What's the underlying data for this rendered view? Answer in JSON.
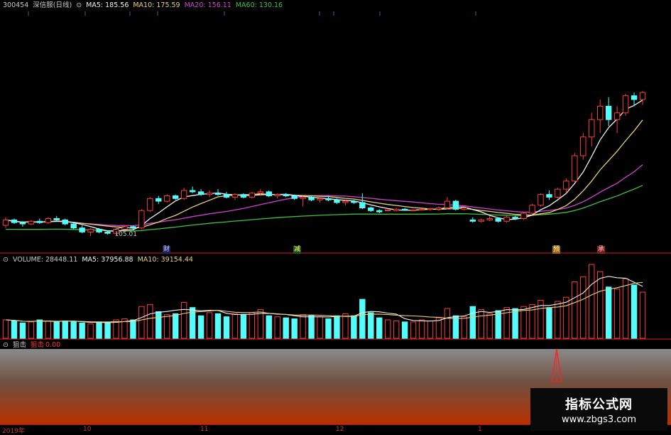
{
  "price": {
    "legend": {
      "code": "300454",
      "name": "深信服(日线)",
      "ma5": "MA5: 185.56",
      "ma10": "MA10: 175.59",
      "ma20": "MA20: 156.11",
      "ma60": "MA60: 130.16"
    },
    "low_label": "105.01",
    "markers": [
      "财",
      "减",
      "预",
      "承"
    ]
  },
  "volume": {
    "legend": {
      "volume": "VOLUME: 28448.11",
      "ma5": "MA5: 37956.88",
      "ma10": "MA10: 39154.44"
    }
  },
  "indicator": {
    "name": "狙击",
    "label": "狙击",
    "value": "0.00"
  },
  "x_axis": [
    "2019年",
    "10",
    "11",
    "12",
    "1"
  ],
  "brand": {
    "line1": "指标公式网",
    "line2": "www.zbgs3.com"
  },
  "colors": {
    "up": "#ff3a3a",
    "down": "#54fcfc",
    "ma5": "#f0f0f0",
    "ma10": "#e8d07a",
    "ma20": "#d040d0",
    "ma60": "#40c040",
    "axis": "#b01818"
  },
  "chart_data": {
    "type": "candlestick",
    "candles": [
      [
        106,
        112,
        104,
        110
      ],
      [
        110,
        111,
        107,
        108
      ],
      [
        108,
        109,
        105,
        107
      ],
      [
        107,
        110,
        106,
        109
      ],
      [
        109,
        111,
        107,
        108
      ],
      [
        108,
        112,
        107,
        111
      ],
      [
        111,
        113,
        109,
        110
      ],
      [
        110,
        111,
        106,
        107
      ],
      [
        107,
        108,
        103,
        104
      ],
      [
        104,
        106,
        100,
        101
      ],
      [
        101,
        104,
        98,
        103
      ],
      [
        103,
        104,
        100,
        101
      ],
      [
        101,
        102,
        99,
        100
      ],
      [
        100,
        104,
        99,
        103
      ],
      [
        103,
        106,
        105.01,
        105
      ],
      [
        105,
        106,
        103,
        104
      ],
      [
        104,
        118,
        103,
        117
      ],
      [
        117,
        127,
        116,
        126
      ],
      [
        126,
        128,
        122,
        124
      ],
      [
        124,
        129,
        123,
        128
      ],
      [
        128,
        129,
        125,
        126
      ],
      [
        126,
        134,
        125,
        132
      ],
      [
        132,
        135,
        130,
        131
      ],
      [
        131,
        133,
        128,
        129
      ],
      [
        129,
        132,
        127,
        130
      ],
      [
        130,
        133,
        128,
        129
      ],
      [
        129,
        131,
        126,
        127
      ],
      [
        127,
        130,
        125,
        129
      ],
      [
        129,
        130,
        126,
        127
      ],
      [
        127,
        131,
        126,
        130
      ],
      [
        130,
        133,
        128,
        131
      ],
      [
        131,
        132,
        127,
        128
      ],
      [
        128,
        130,
        126,
        129
      ],
      [
        129,
        130,
        127,
        128
      ],
      [
        128,
        129,
        125,
        126
      ],
      [
        126,
        128,
        120,
        127
      ],
      [
        127,
        128,
        124,
        125
      ],
      [
        125,
        127,
        123,
        126
      ],
      [
        126,
        128,
        124,
        125
      ],
      [
        125,
        126,
        122,
        123
      ],
      [
        123,
        125,
        121,
        124
      ],
      [
        124,
        125,
        122,
        123
      ],
      [
        123,
        130,
        118,
        119
      ],
      [
        119,
        120,
        116,
        117
      ],
      [
        117,
        118,
        115,
        116
      ],
      [
        117,
        118,
        117,
        117.5
      ],
      [
        117,
        119,
        116.5,
        118
      ],
      [
        118,
        119,
        117,
        117.5
      ],
      [
        117,
        118,
        116.5,
        117.5
      ],
      [
        117.5,
        118.5,
        117,
        118
      ],
      [
        118,
        119,
        117,
        118.5
      ],
      [
        118,
        120,
        117,
        119
      ],
      [
        119,
        127,
        118,
        124
      ],
      [
        124,
        125,
        117,
        118
      ],
      [
        118,
        120,
        117,
        119
      ],
      [
        110,
        112,
        108,
        109
      ],
      [
        109,
        111,
        108,
        110
      ],
      [
        110,
        113,
        109,
        111
      ],
      [
        111,
        112,
        108,
        109
      ],
      [
        109,
        113,
        108,
        112
      ],
      [
        112,
        113,
        110,
        111
      ],
      [
        111,
        116,
        110,
        115
      ],
      [
        115,
        122,
        114,
        121
      ],
      [
        121,
        130,
        120,
        129
      ],
      [
        129,
        132,
        125,
        127
      ],
      [
        127,
        134,
        126,
        133
      ],
      [
        133,
        141,
        130,
        139
      ],
      [
        139,
        160,
        138,
        158
      ],
      [
        158,
        175,
        155,
        172
      ],
      [
        172,
        190,
        165,
        185
      ],
      [
        185,
        200,
        175,
        195
      ],
      [
        195,
        205,
        180,
        185
      ],
      [
        185,
        195,
        175,
        190
      ],
      [
        190,
        212,
        188,
        208
      ],
      [
        208,
        215,
        195,
        200
      ],
      [
        200,
        218,
        196,
        215
      ]
    ],
    "volumes": [
      18,
      17,
      15,
      16,
      18,
      17,
      16,
      17,
      16,
      15,
      14,
      16,
      15,
      18,
      19,
      18,
      31,
      33,
      26,
      23,
      24,
      35,
      30,
      22,
      25,
      24,
      21,
      24,
      23,
      25,
      28,
      22,
      21,
      20,
      19,
      23,
      22,
      21,
      19,
      22,
      24,
      22,
      38,
      25,
      20,
      18,
      17,
      16,
      16,
      18,
      17,
      20,
      29,
      22,
      21,
      31,
      28,
      24,
      27,
      30,
      29,
      31,
      33,
      37,
      30,
      36,
      40,
      55,
      60,
      72,
      65,
      50,
      48,
      58,
      52,
      45
    ],
    "ma_volume_values": "computed",
    "indicator_values": "signal spike near the right side"
  }
}
